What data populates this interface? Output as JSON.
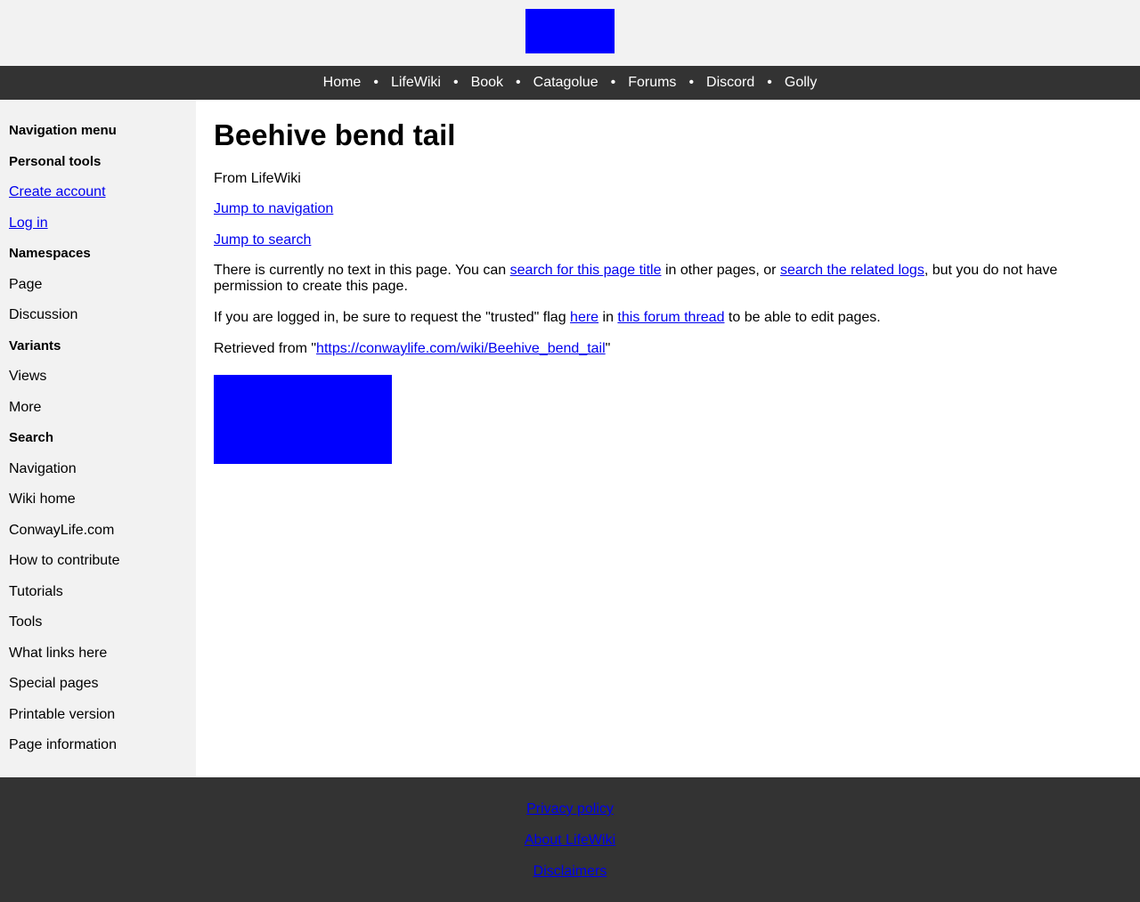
{
  "brand": {
    "logo_color": "#0000ff"
  },
  "nav": {
    "items": [
      "Home",
      "LifeWiki",
      "Book",
      "Catagolue",
      "Forums",
      "Discord",
      "Golly"
    ],
    "separator": "•"
  },
  "sidebar": {
    "navigation_menu": "Navigation menu",
    "personal_tools": "Personal tools",
    "create_account": "Create account",
    "log_in": "Log in",
    "namespaces": "Namespaces",
    "page": "Page",
    "discussion": "Discussion",
    "variants": "Variants",
    "views": "Views",
    "more": "More",
    "search": "Search",
    "navigation": "Navigation",
    "wiki_home": "Wiki home",
    "conwaylife": "ConwayLife.com",
    "how_to_contribute": "How to contribute",
    "tutorials": "Tutorials",
    "tools": "Tools",
    "what_links_here": "What links here",
    "special_pages": "Special pages",
    "printable_version": "Printable version",
    "page_information": "Page information"
  },
  "content": {
    "title": "Beehive bend tail",
    "from": "From LifeWiki",
    "jump_nav": "Jump to navigation",
    "jump_search": "Jump to search",
    "notext_1": "There is currently no text in this page. You can ",
    "notext_link1": "search for this page title",
    "notext_2": " in other pages, or ",
    "notext_link2": "search the related logs",
    "notext_3": ", but you do not have permission to create this page.",
    "trusted_1": "If you are logged in, be sure to request the \"trusted\" flag ",
    "trusted_link1": "here",
    "trusted_2": " in ",
    "trusted_link2": "this forum thread",
    "trusted_3": " to be able to edit pages.",
    "retrieved_1": "Retrieved from \"",
    "retrieved_link": "https://conwaylife.com/wiki/Beehive_bend_tail",
    "retrieved_2": "\"",
    "image_color": "#0000ff"
  },
  "footer": {
    "privacy": "Privacy policy",
    "about": "About LifeWiki",
    "disclaimers": "Disclaimers"
  }
}
